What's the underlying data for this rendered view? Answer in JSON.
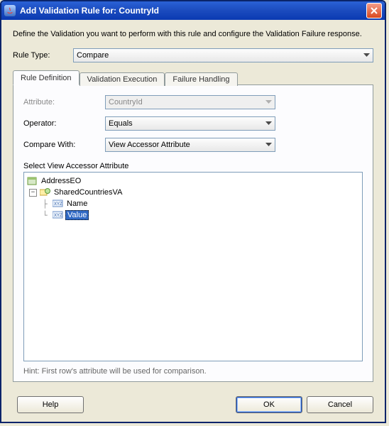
{
  "window": {
    "title": "Add Validation Rule for: CountryId"
  },
  "intro": "Define the Validation you want to perform with this rule and configure the Validation Failure response.",
  "ruleType": {
    "label": "Rule Type:",
    "value": "Compare"
  },
  "tabs": {
    "definition": "Rule Definition",
    "execution": "Validation Execution",
    "failure": "Failure Handling"
  },
  "form": {
    "attribute": {
      "label": "Attribute:",
      "value": "CountryId"
    },
    "operator": {
      "label": "Operator:",
      "value": "Equals"
    },
    "compareWith": {
      "label": "Compare With:",
      "value": "View Accessor Attribute"
    },
    "treeHeading": "Select View Accessor Attribute"
  },
  "tree": {
    "root": "AddressEO",
    "va": "SharedCountriesVA",
    "attr1": "Name",
    "attr2": "Value"
  },
  "hint": "Hint: First row's attribute will be used for comparison.",
  "buttons": {
    "help": "Help",
    "ok": "OK",
    "cancel": "Cancel"
  }
}
